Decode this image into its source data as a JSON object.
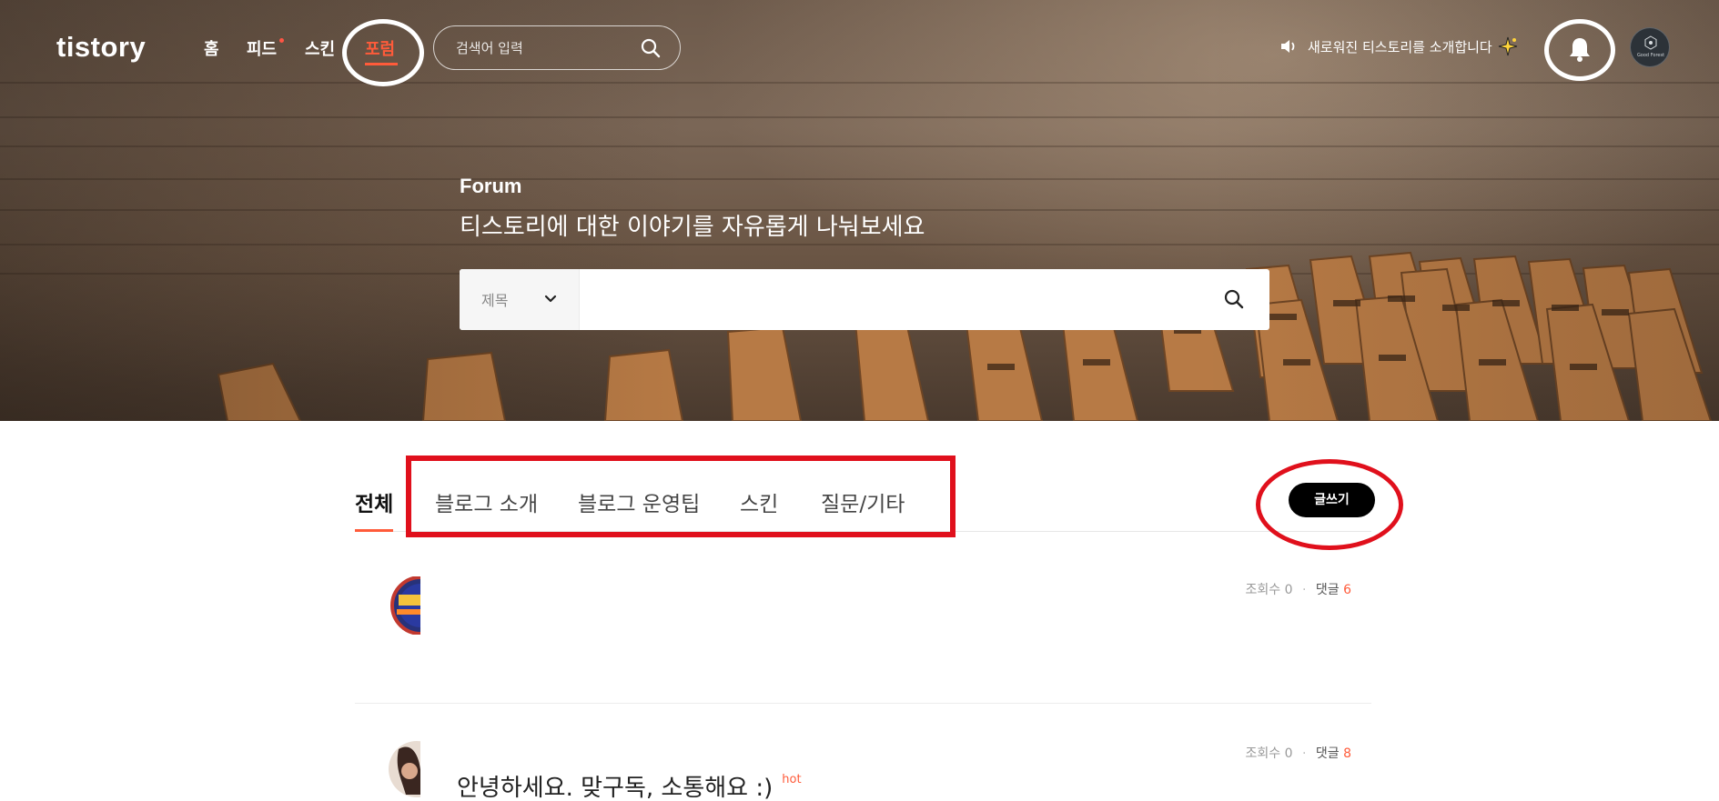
{
  "header": {
    "logo": "tistory",
    "nav": [
      {
        "label": "홈",
        "active": false,
        "dot": false
      },
      {
        "label": "피드",
        "active": false,
        "dot": true
      },
      {
        "label": "스킨",
        "active": false,
        "dot": false
      },
      {
        "label": "포럼",
        "active": true,
        "dot": false
      }
    ],
    "search_placeholder": "검색어 입력",
    "announcement": "새로워진 티스토리를 소개합니다",
    "avatar_text": "Good Forest"
  },
  "hero": {
    "title": "Forum",
    "subtitle": "티스토리에 대한 이야기를 자유롭게 나눠보세요",
    "search_filter": "제목",
    "search_value": ""
  },
  "tabs": [
    {
      "label": "전체",
      "active": true
    },
    {
      "label": "블로그 소개",
      "active": false
    },
    {
      "label": "블로그 운영팁",
      "active": false
    },
    {
      "label": "스킨",
      "active": false
    },
    {
      "label": "질문/기타",
      "active": false
    }
  ],
  "write_button": "글쓰기",
  "posts": [
    {
      "title": "",
      "views_label": "조회수",
      "views": "0",
      "comments_label": "댓글",
      "comments": "6",
      "hot": ""
    },
    {
      "title": "안녕하세요. 맞구독, 소통해요 :)",
      "views_label": "조회수",
      "views": "0",
      "comments_label": "댓글",
      "comments": "8",
      "hot": "hot"
    }
  ],
  "colors": {
    "accent": "#ff5b3a",
    "annotation_red": "#e0101c",
    "annotation_white": "#ffffff"
  }
}
